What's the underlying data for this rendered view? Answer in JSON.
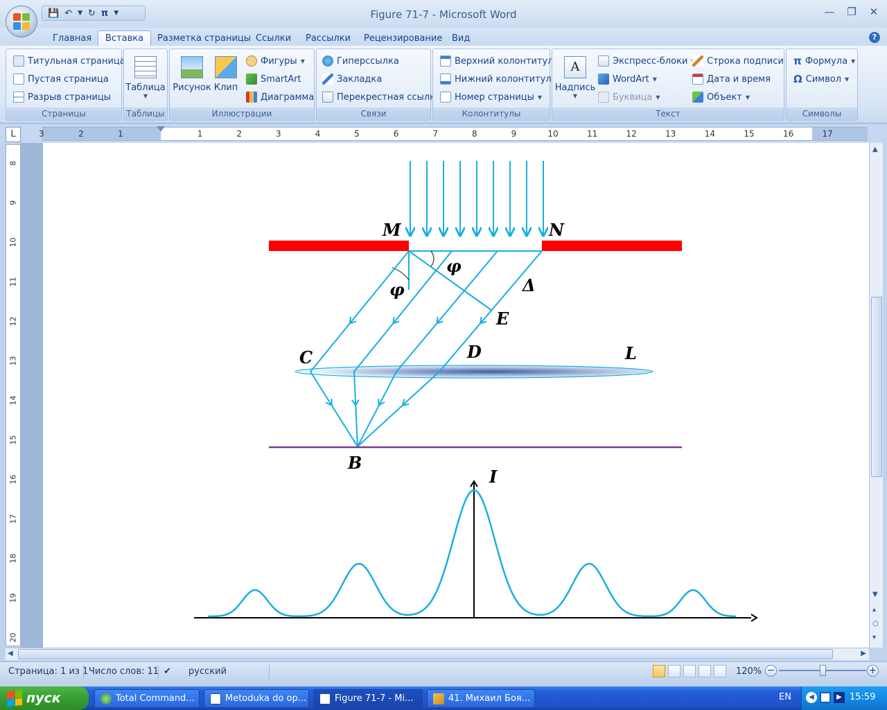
{
  "window": {
    "title": "Figure 71-7 - Microsoft Word"
  },
  "tabs": [
    {
      "label": "Главная"
    },
    {
      "label": "Вставка",
      "active": true
    },
    {
      "label": "Разметка страницы"
    },
    {
      "label": "Ссылки"
    },
    {
      "label": "Рассылки"
    },
    {
      "label": "Рецензирование"
    },
    {
      "label": "Вид"
    }
  ],
  "ribbon": {
    "pages": {
      "label": "Страницы",
      "cover": "Титульная страница",
      "blank": "Пустая страница",
      "break": "Разрыв страницы"
    },
    "tables": {
      "label": "Таблицы",
      "table": "Таблица"
    },
    "illustrations": {
      "label": "Иллюстрации",
      "picture": "Рисунок",
      "clip": "Клип",
      "shapes": "Фигуры",
      "smartart": "SmartArt",
      "chart": "Диаграмма"
    },
    "links": {
      "label": "Связи",
      "hyperlink": "Гиперссылка",
      "bookmark": "Закладка",
      "crossref": "Перекрестная ссылка"
    },
    "headers": {
      "label": "Колонтитулы",
      "header": "Верхний колонтитул",
      "footer": "Нижний колонтитул",
      "pagenum": "Номер страницы"
    },
    "text": {
      "label": "Текст",
      "textbox": "Надпись",
      "quickparts": "Экспресс-блоки",
      "wordart": "WordArt",
      "dropcap": "Буквица",
      "sigline": "Строка подписи",
      "datetime": "Дата и время",
      "object": "Объект"
    },
    "symbols": {
      "label": "Символы",
      "equation": "Формула",
      "symbol": "Символ"
    }
  },
  "ruler": {
    "h": [
      "3",
      "2",
      "1",
      "1",
      "2",
      "3",
      "4",
      "5",
      "6",
      "7",
      "8",
      "9",
      "10",
      "11",
      "12",
      "13",
      "14",
      "15",
      "16",
      "17"
    ],
    "v": [
      "8",
      "9",
      "10",
      "11",
      "12",
      "13",
      "14",
      "15",
      "16",
      "17",
      "18",
      "19",
      "20"
    ]
  },
  "figure": {
    "labels": {
      "M": "M",
      "N": "N",
      "phi1": "φ",
      "phi2": "φ",
      "delta": "Δ",
      "E": "E",
      "C": "C",
      "D": "D",
      "L": "L",
      "B": "B",
      "I": "I"
    }
  },
  "status": {
    "page": "Страница: 1 из 1",
    "words": "Число слов: 11",
    "lang": "русский",
    "zoom": "120%"
  },
  "taskbar": {
    "start": "пуск",
    "tasks": [
      {
        "label": "Total Command..."
      },
      {
        "label": "Metoduka do op..."
      },
      {
        "label": "Figure 71-7 - Mi...",
        "active": true
      },
      {
        "label": "41. Михаил Боя..."
      }
    ],
    "lang": "EN",
    "clock": "15:59"
  },
  "colors": {
    "ray": "#1aaee0",
    "screen": "#ff0000",
    "baseline": "#7a3a8c",
    "accent": "#15428b"
  }
}
